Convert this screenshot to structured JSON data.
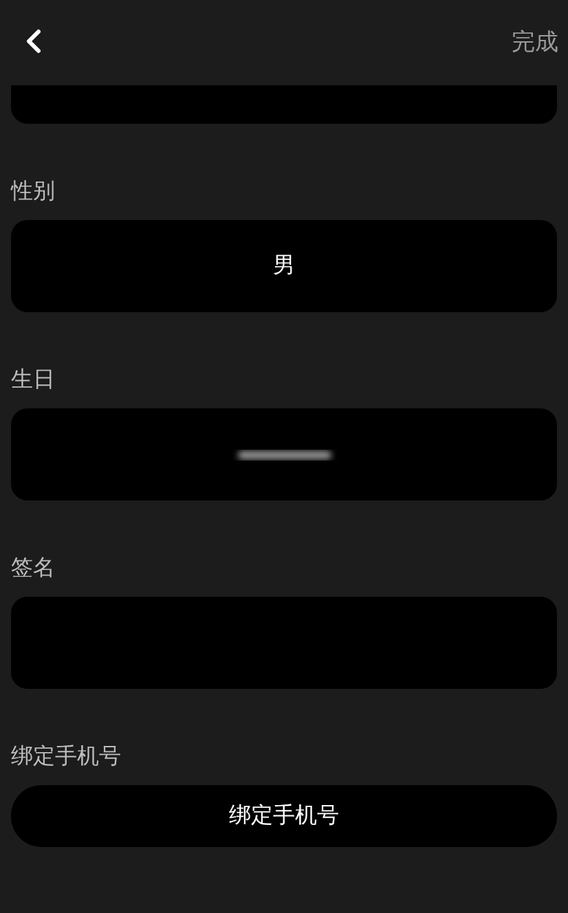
{
  "header": {
    "done": "完成"
  },
  "fields": [
    {
      "label": "性别",
      "kind": "value",
      "value": "男"
    },
    {
      "label": "生日",
      "kind": "blurred"
    },
    {
      "label": "签名",
      "kind": "empty"
    },
    {
      "label": "绑定手机号",
      "kind": "button",
      "value": "绑定手机号"
    }
  ]
}
